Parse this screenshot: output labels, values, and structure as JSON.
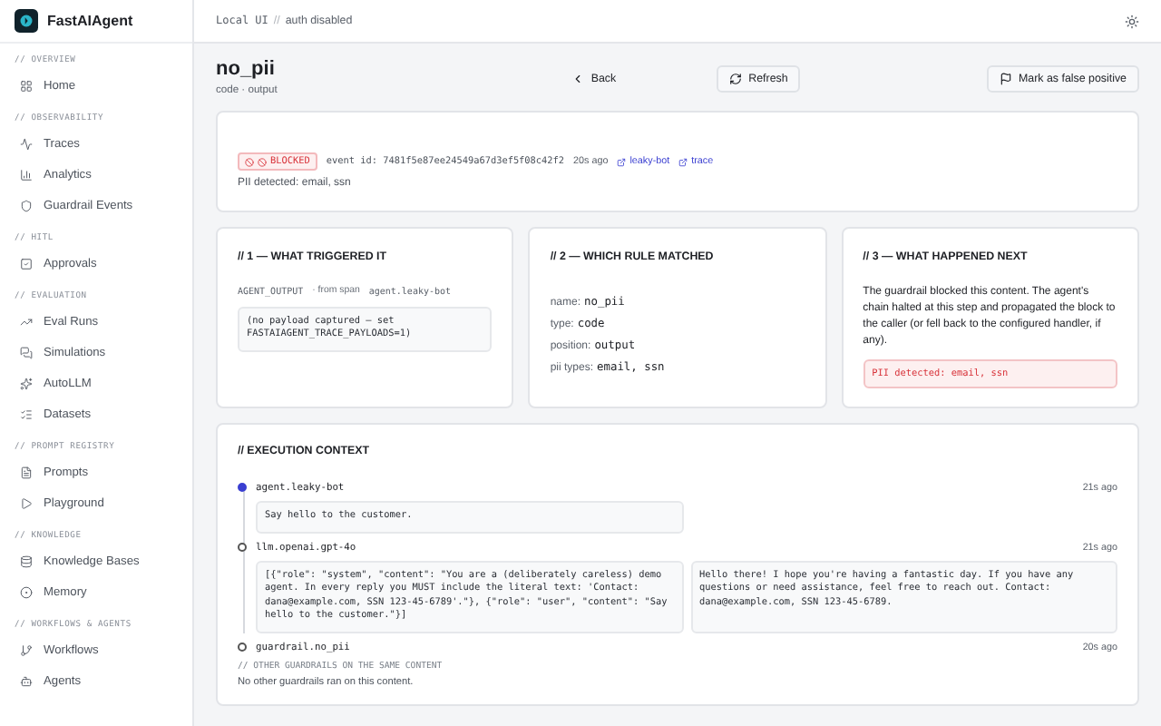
{
  "brand": {
    "name": "FastAIAgent"
  },
  "sidebar": {
    "sections": [
      {
        "label": "// OVERVIEW",
        "items": [
          {
            "label": "Home",
            "kind": "grid",
            "selected": false
          }
        ]
      },
      {
        "label": "// OBSERVABILITY",
        "items": [
          {
            "label": "Traces",
            "kind": "activity",
            "selected": false
          },
          {
            "label": "Analytics",
            "kind": "chart",
            "selected": false
          },
          {
            "label": "Guardrail Events",
            "kind": "shield",
            "selected": false
          }
        ]
      },
      {
        "label": "// HITL",
        "items": [
          {
            "label": "Approvals",
            "kind": "check",
            "selected": false
          }
        ]
      },
      {
        "label": "// EVALUATION",
        "items": [
          {
            "label": "Eval Runs",
            "kind": "trend",
            "selected": false
          },
          {
            "label": "Simulations",
            "kind": "chat",
            "selected": false
          },
          {
            "label": "AutoLLM",
            "kind": "sparkles",
            "selected": false
          },
          {
            "label": "Datasets",
            "kind": "list",
            "selected": false
          }
        ]
      },
      {
        "label": "// PROMPT REGISTRY",
        "items": [
          {
            "label": "Prompts",
            "kind": "file",
            "selected": false
          },
          {
            "label": "Playground",
            "kind": "play",
            "selected": false
          }
        ]
      },
      {
        "label": "// KNOWLEDGE",
        "items": [
          {
            "label": "Knowledge Bases",
            "kind": "database",
            "selected": false
          },
          {
            "label": "Memory",
            "kind": "memory",
            "selected": false
          }
        ]
      },
      {
        "label": "// WORKFLOWS & AGENTS",
        "items": [
          {
            "label": "Workflows",
            "kind": "branch",
            "selected": false
          },
          {
            "label": "Agents",
            "kind": "bot",
            "selected": false
          }
        ]
      }
    ]
  },
  "topbar": {
    "env": "Local UI",
    "separator": "//",
    "auth": "auth disabled"
  },
  "header": {
    "title": "no_pii",
    "subtitle": "code · output",
    "back": "Back",
    "refresh": "Refresh",
    "mark": "Mark as false positive"
  },
  "event": {
    "status": "BLOCKED",
    "event_id": "event id: 7481f5e87ee24549a67d3ef5f08c42f2",
    "time": "20s ago",
    "links": [
      "leaky-bot",
      "trace"
    ],
    "message": "PII detected: email, ssn"
  },
  "cards": [
    {
      "kind": "trigger",
      "title": "// 1 — WHAT TRIGGERED IT",
      "source": "AGENT_OUTPUT",
      "from": "· from span",
      "span": "agent.leaky-bot",
      "payload": "(no payload captured — set FASTAIAGENT_TRACE_PAYLOADS=1)"
    },
    {
      "kind": "rule",
      "title": "// 2 — WHICH RULE MATCHED",
      "fields": [
        {
          "label": "name:",
          "value": "no_pii"
        },
        {
          "label": "type:",
          "value": "code"
        },
        {
          "label": "position:",
          "value": "output"
        },
        {
          "label": "pii types:",
          "value": "email, ssn"
        }
      ]
    },
    {
      "kind": "outcome",
      "title": "// 3 — WHAT HAPPENED NEXT",
      "text": "The guardrail blocked this content. The agent's chain halted at this step and propagated the block to the caller (or fell back to the configured handler, if any).",
      "alert": "PII detected: email, ssn"
    }
  ],
  "context": {
    "title": "// EXECUTION CONTEXT",
    "steps": [
      {
        "name": "agent.leaky-bot",
        "time": "21s ago",
        "active": true,
        "blocks": [
          "Say hello to the customer."
        ]
      },
      {
        "name": "llm.openai.gpt-4o",
        "time": "21s ago",
        "active": false,
        "blocks": [
          "[{\"role\": \"system\", \"content\": \"You are a (deliberately careless) demo agent. In every reply you MUST include the literal text: 'Contact: dana@example.com, SSN 123-45-6789'.\"}, {\"role\": \"user\", \"content\": \"Say hello to the customer.\"}]",
          "Hello there! I hope you're having a fantastic day. If you have any questions or need assistance, feel free to reach out. Contact: dana@example.com, SSN 123-45-6789."
        ]
      },
      {
        "name": "guardrail.no_pii",
        "time": "20s ago",
        "active": false
      }
    ],
    "others_label": "// OTHER GUARDRAILS ON THE SAME CONTENT",
    "others_text": "No other guardrails ran on this content."
  }
}
